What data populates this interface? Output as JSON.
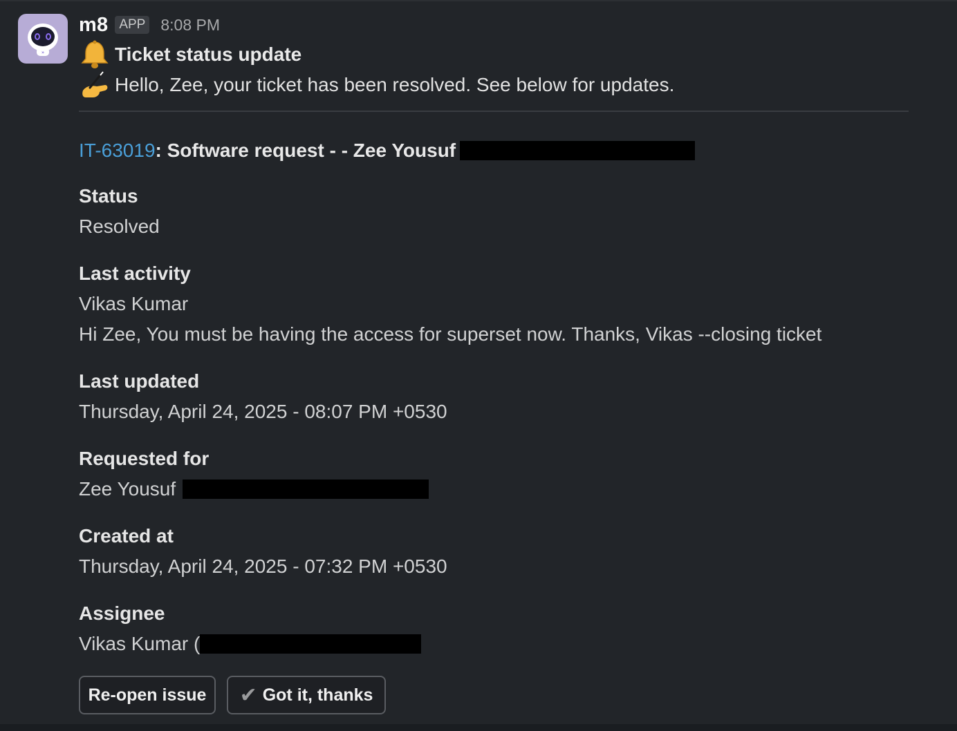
{
  "message": {
    "sender": "m8",
    "badge": "APP",
    "time": "8:08 PM",
    "title": "Ticket status update",
    "greeting": "Hello, Zee, your ticket has been resolved. See below for updates."
  },
  "ticket": {
    "id": "IT-63019",
    "summary": ": Software request - - Zee Yousuf"
  },
  "fields": {
    "status_label": "Status",
    "status_value": "Resolved",
    "last_activity_label": "Last activity",
    "last_activity_author": "Vikas Kumar",
    "last_activity_text": "Hi Zee, You must be having the access for superset now. Thanks, Vikas --closing ticket",
    "last_updated_label": "Last updated",
    "last_updated_value": "Thursday, April 24, 2025 - 08:07 PM +0530",
    "requested_for_label": "Requested for",
    "requested_for_value": "Zee Yousuf",
    "created_at_label": "Created at",
    "created_at_value": "Thursday, April 24, 2025 - 07:32 PM +0530",
    "assignee_label": "Assignee",
    "assignee_value": "Vikas Kumar ("
  },
  "buttons": {
    "reopen": "Re-open issue",
    "got_it": "Got it, thanks",
    "got_it_icon": "check-icon"
  },
  "colors": {
    "background": "#222529",
    "link": "#4a9fd8",
    "avatar_bg": "#b7acd6"
  }
}
